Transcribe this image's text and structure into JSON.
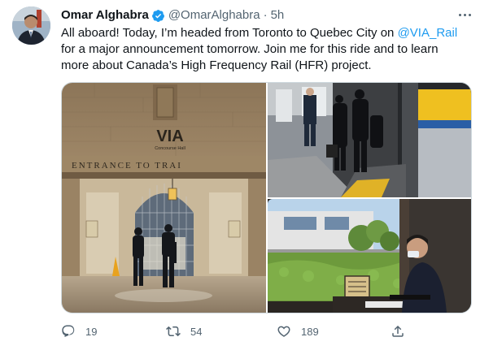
{
  "tweet": {
    "author": {
      "display_name": "Omar Alghabra",
      "handle": "@OmarAlghabra",
      "time": "5h",
      "verified": true,
      "avatar_icon": "user-avatar"
    },
    "text": {
      "part1": "All aboard! Today, I’m headed from Toronto to Quebec City on ",
      "mention": "@VIA_Rail",
      "part2": " for a major announcement tomorrow. Join me for this ride and to learn more about Canada’s High Frequency Rail (HFR) project."
    },
    "media": {
      "photo1_sign": "VIA",
      "photo1_sign_sub": "Concourse Hall",
      "photo1_frieze": "ENTRANCE   TO   TRAI"
    },
    "actions": {
      "reply": {
        "icon": "reply-icon",
        "count": "19"
      },
      "retweet": {
        "icon": "retweet-icon",
        "count": "54"
      },
      "like": {
        "icon": "heart-icon",
        "count": "189"
      },
      "share": {
        "icon": "share-icon"
      }
    }
  },
  "colors": {
    "accent": "#1d9bf0",
    "text_primary": "#0f1419",
    "text_secondary": "#536471",
    "border": "#cfd9de"
  }
}
